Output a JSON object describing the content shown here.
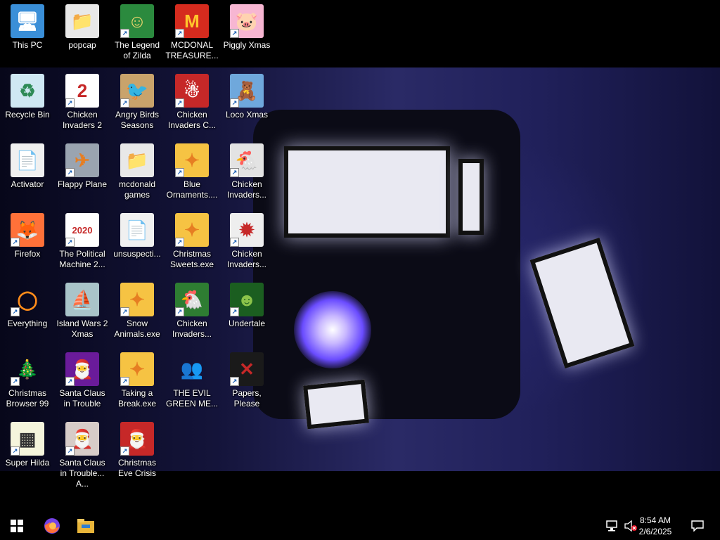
{
  "desktop": {
    "icons": [
      {
        "label": "This PC",
        "glyph": "🖥",
        "bg": "#3a8fd8",
        "color": "#fff",
        "shortcut": false,
        "icon": "computer-icon"
      },
      {
        "label": "popcap",
        "glyph": "📁",
        "bg": "#e8e8e8",
        "color": "#333",
        "shortcut": false,
        "icon": "folder-icon"
      },
      {
        "label": "The Legend of Zilda",
        "glyph": "☺",
        "bg": "#2b8a3e",
        "color": "#f5d76e",
        "shortcut": true,
        "icon": "game-zilda-icon"
      },
      {
        "label": "MCDONAL TREASURE...",
        "glyph": "M",
        "bg": "#d52b1e",
        "color": "#ffc72c",
        "shortcut": true,
        "icon": "mcdonald-icon"
      },
      {
        "label": "Piggly Xmas",
        "glyph": "🐷",
        "bg": "#f7b6d2",
        "color": "#c2185b",
        "shortcut": true,
        "icon": "pig-icon"
      },
      {
        "label": "Recycle Bin",
        "glyph": "♻",
        "bg": "#cfe8f3",
        "color": "#2e8b57",
        "shortcut": false,
        "icon": "recycle-bin-icon"
      },
      {
        "label": "Chicken Invaders 2",
        "glyph": "2",
        "bg": "#ffffff",
        "color": "#c62828",
        "shortcut": true,
        "icon": "chicken-invaders-icon"
      },
      {
        "label": "Angry Birds Seasons",
        "glyph": "🐦",
        "bg": "#c9a36b",
        "color": "#b71c1c",
        "shortcut": true,
        "icon": "angry-birds-icon"
      },
      {
        "label": "Chicken Invaders C...",
        "glyph": "☃",
        "bg": "#c62828",
        "color": "#fff",
        "shortcut": true,
        "icon": "chicken-invaders-icon"
      },
      {
        "label": "Loco Xmas",
        "glyph": "🧸",
        "bg": "#6fa8dc",
        "color": "#8b4513",
        "shortcut": true,
        "icon": "bear-icon"
      },
      {
        "label": "Activator",
        "glyph": "📄",
        "bg": "#f0f0f0",
        "color": "#3a8a3a",
        "shortcut": false,
        "icon": "file-icon"
      },
      {
        "label": "Flappy Plane",
        "glyph": "✈",
        "bg": "#9aa4b0",
        "color": "#e67e22",
        "shortcut": true,
        "icon": "plane-icon"
      },
      {
        "label": "mcdonald games",
        "glyph": "📁",
        "bg": "#e8e8e8",
        "color": "#333",
        "shortcut": false,
        "icon": "folder-icon"
      },
      {
        "label": "Blue Ornaments....",
        "glyph": "✦",
        "bg": "#f6c343",
        "color": "#e67e22",
        "shortcut": true,
        "icon": "ornament-icon"
      },
      {
        "label": "Chicken Invaders...",
        "glyph": "🐔",
        "bg": "#e3e3e3",
        "color": "#c62828",
        "shortcut": true,
        "icon": "chicken-invaders-icon"
      },
      {
        "label": "Firefox",
        "glyph": "🦊",
        "bg": "#ff7139",
        "color": "#7542e5",
        "shortcut": true,
        "icon": "firefox-icon"
      },
      {
        "label": "The Political Machine 2...",
        "glyph": "2020",
        "bg": "#ffffff",
        "color": "#c62828",
        "shortcut": true,
        "icon": "political-machine-icon"
      },
      {
        "label": "unsuspecti...",
        "glyph": "📄",
        "bg": "#f0f0f0",
        "color": "#777",
        "shortcut": false,
        "icon": "file-icon"
      },
      {
        "label": "Christmas Sweets.exe",
        "glyph": "✦",
        "bg": "#f6c343",
        "color": "#e67e22",
        "shortcut": true,
        "icon": "ornament-icon"
      },
      {
        "label": "Chicken Invaders...",
        "glyph": "✹",
        "bg": "#eeeeee",
        "color": "#c62828",
        "shortcut": true,
        "icon": "chicken-invaders-icon"
      },
      {
        "label": "Everything",
        "glyph": "◯",
        "bg": "transparent",
        "color": "#ff8c1a",
        "shortcut": true,
        "icon": "search-icon"
      },
      {
        "label": "Island Wars 2 Xmas",
        "glyph": "⛵",
        "bg": "#a9c4c9",
        "color": "#2f4f4f",
        "shortcut": false,
        "icon": "island-icon"
      },
      {
        "label": "Snow Animals.exe",
        "glyph": "✦",
        "bg": "#f6c343",
        "color": "#e67e22",
        "shortcut": true,
        "icon": "ornament-icon"
      },
      {
        "label": "Chicken Invaders...",
        "glyph": "🐔",
        "bg": "#2e7d32",
        "color": "#fbc02d",
        "shortcut": true,
        "icon": "chicken-invaders-icon"
      },
      {
        "label": "Undertale",
        "glyph": "☻",
        "bg": "#1b5e20",
        "color": "#8bc34a",
        "shortcut": true,
        "icon": "undertale-icon"
      },
      {
        "label": "Christmas Browser 99",
        "glyph": "🎄",
        "bg": "transparent",
        "color": "#2e7d32",
        "shortcut": true,
        "icon": "tree-icon"
      },
      {
        "label": "Santa Claus in Trouble",
        "glyph": "🎅",
        "bg": "#6a1b9a",
        "color": "#fff",
        "shortcut": true,
        "icon": "santa-icon"
      },
      {
        "label": "Taking a Break.exe",
        "glyph": "✦",
        "bg": "#f6c343",
        "color": "#e67e22",
        "shortcut": true,
        "icon": "ornament-icon"
      },
      {
        "label": "THE EVIL GREEN ME...",
        "glyph": "👥",
        "bg": "transparent",
        "color": "#4caf50",
        "shortcut": false,
        "icon": "messenger-icon"
      },
      {
        "label": "Papers, Please",
        "glyph": "✕",
        "bg": "#1a1a1a",
        "color": "#c62828",
        "shortcut": true,
        "icon": "papers-please-icon"
      },
      {
        "label": "Super Hilda",
        "glyph": "▦",
        "bg": "#f5f5dc",
        "color": "#333",
        "shortcut": true,
        "icon": "hilda-icon"
      },
      {
        "label": "Santa Claus in Trouble... A...",
        "glyph": "🎅",
        "bg": "#d7ccc8",
        "color": "#5d4037",
        "shortcut": true,
        "icon": "santa-icon"
      },
      {
        "label": "Christmas Eve Crisis",
        "glyph": "🎅",
        "bg": "#c62828",
        "color": "#fff",
        "shortcut": true,
        "icon": "santa-icon"
      }
    ]
  },
  "taskbar": {
    "time": "8:54 AM",
    "date": "2/6/2025"
  },
  "colors": {
    "taskbar_bg": "#000000",
    "icon_label": "#ffffff",
    "accent_blue": "#1a5fb4"
  }
}
